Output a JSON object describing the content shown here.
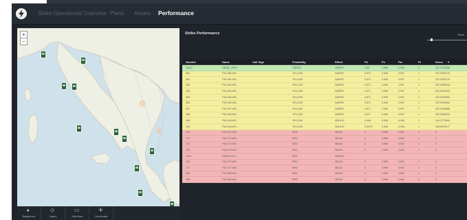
{
  "header": {
    "nav": [
      "Strike Operational Overview",
      "Plans",
      "Assets",
      "Performance"
    ],
    "active_index": 3
  },
  "map_tools": [
    {
      "label": "Background",
      "icon": "globe-icon",
      "glyph": "◕"
    },
    {
      "label": "Layers",
      "icon": "layers-icon",
      "glyph": "◇"
    },
    {
      "label": "View Area",
      "icon": "view-area-icon",
      "glyph": "▭"
    },
    {
      "label": "Coordinates",
      "icon": "crosshair-icon",
      "glyph": "✛"
    }
  ],
  "map_zoom": {
    "in": "+",
    "out": "−"
  },
  "table": {
    "title": "Strike Performance",
    "show_label": "Show",
    "columns": [
      "Number",
      "Name",
      "Call Sign",
      "Feasibility",
      "Effect",
      "Pk",
      "Ps",
      "Pw",
      "Pt",
      "Score"
    ],
    "score_sort_indicator": "▾",
    "rows": [
      {
        "cells": [
          "16112",
          "NAVAL_SHIP...",
          "",
          "GREEN",
          "NARRG",
          "0.85",
          "0.996",
          "0.999",
          "1",
          "201.4175286"
        ],
        "status": "green"
      },
      {
        "cells": [
          "350",
          "P16-350-WS...",
          "",
          "YELLOW",
          "NARRG",
          "0.571",
          "0.996",
          "0.997",
          "1",
          "222.5155744"
        ],
        "status": "yellow"
      },
      {
        "cells": [
          "351",
          "P16-351-WS...",
          "",
          "YELLOW",
          "NARRG",
          "0.571",
          "0.996",
          "0.997",
          "1",
          "222.5155175"
        ],
        "status": "yellow"
      },
      {
        "cells": [
          "352",
          "P16-352-WS...",
          "",
          "YELLOW",
          "NARRG",
          "0.571",
          "0.996",
          "0.997",
          "1",
          "222.5155218"
        ],
        "status": "yellow"
      },
      {
        "cells": [
          "353",
          "P16-353-WS...",
          "",
          "YELLOW",
          "NARRG",
          "0.571",
          "0.996",
          "0.997",
          "1",
          "222.5155152"
        ],
        "status": "yellow"
      },
      {
        "cells": [
          "354",
          "P16-354-WS...",
          "",
          "YELLOW",
          "NARRG",
          "0.571",
          "0.996",
          "0.997",
          "1",
          "222.5155080"
        ],
        "status": "yellow"
      },
      {
        "cells": [
          "355",
          "P16-355-WS...",
          "",
          "YELLOW",
          "NARRG",
          "0.571",
          "0.996",
          "0.997",
          "1",
          "222.5154904"
        ],
        "status": "yellow"
      },
      {
        "cells": [
          "357",
          "P16-357-WS...",
          "",
          "YELLOW",
          "NARRG",
          "0.571",
          "0.996",
          "0.997",
          "1",
          "222.5154858"
        ],
        "status": "yellow"
      },
      {
        "cells": [
          "356",
          "P16-356-WS...",
          "",
          "YELLOW",
          "NARRG",
          "0.571",
          "0.996",
          "0.997",
          "1",
          "222.5154670"
        ],
        "status": "yellow"
      },
      {
        "cells": [
          "248",
          "P16-248-WS...",
          "",
          "YELLOW",
          "SBLD10",
          "0.546",
          "0.996",
          "0.996",
          "1",
          "214.0773900"
        ],
        "status": "yellow"
      },
      {
        "cells": [
          "249",
          "P16-249-WS...",
          "",
          "YELLOW",
          "SBLD10",
          "0.5375",
          "0.996",
          "0.996",
          "1",
          "205.0875177"
        ],
        "status": "yellow"
      },
      {
        "cells": [
          "272",
          "P16-272-WS...",
          "",
          "RED",
          "SBLD2",
          "0",
          "0.996",
          "0.991",
          "1",
          "0"
        ],
        "status": "red"
      },
      {
        "cells": [
          "273",
          "P16-273-WS...",
          "",
          "RED",
          "SBLD2",
          "0",
          "0.996",
          "0.991",
          "1",
          "0"
        ],
        "status": "red"
      },
      {
        "cells": [
          "274",
          "P16-274-WS...",
          "",
          "RED",
          "SBLD2",
          "0",
          "0.996",
          "0.991",
          "1",
          "0"
        ],
        "status": "red"
      },
      {
        "cells": [
          "275",
          "P16-275-WS...",
          "",
          "RED",
          "SBLD2",
          "0",
          "0.996",
          "0.991",
          "1",
          "0"
        ],
        "status": "red"
      },
      {
        "cells": [
          "1476",
          "PATROL107...",
          "",
          "RED",
          "NAR104",
          "",
          "",
          "",
          "",
          ""
        ],
        "status": "red"
      },
      {
        "cells": [
          "276",
          "P16-276-WS...",
          "",
          "RED",
          "SBLD2",
          "0",
          "0.996",
          "0.991",
          "1",
          "0"
        ],
        "status": "red"
      },
      {
        "cells": [
          "277",
          "P16-277-WS...",
          "",
          "RED",
          "SBLD2",
          "0",
          "0.996",
          "0.991",
          "1",
          "0"
        ],
        "status": "red"
      },
      {
        "cells": [
          "358",
          "P16-358-WS...",
          "",
          "RED",
          "SBLD2",
          "0",
          "0.996",
          "0.991",
          "1",
          "0"
        ],
        "status": "red"
      },
      {
        "cells": [
          "359",
          "P16-359-WS...",
          "",
          "RED",
          "SBLD2",
          "0",
          "0.996",
          "0.991",
          "1",
          "0"
        ],
        "status": "red"
      }
    ]
  },
  "colors": {
    "green_row": "#bfe8b3",
    "yellow_row": "#f4ee9e",
    "red_row": "#f3b5b5",
    "header_bg": "#262c33",
    "sea": "#cfe1ea",
    "land": "#eef0e6"
  }
}
